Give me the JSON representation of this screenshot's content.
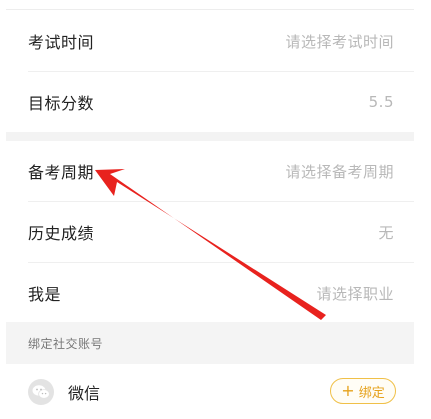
{
  "rows_group1": [
    {
      "label": "考试时间",
      "value": "请选择考试时间"
    },
    {
      "label": "目标分数",
      "value": "5.5"
    }
  ],
  "rows_group2": [
    {
      "label": "备考周期",
      "value": "请选择备考周期"
    },
    {
      "label": "历史成绩",
      "value": "无"
    },
    {
      "label": "我是",
      "value": "请选择职业"
    }
  ],
  "social_section": {
    "title": "绑定社交账号",
    "wechat_label": "微信",
    "bind_label": "绑定",
    "bind_plus": "+"
  },
  "colors": {
    "accent": "#e6a21c",
    "arrow": "#e8221e",
    "placeholder": "#b8b8b8"
  }
}
